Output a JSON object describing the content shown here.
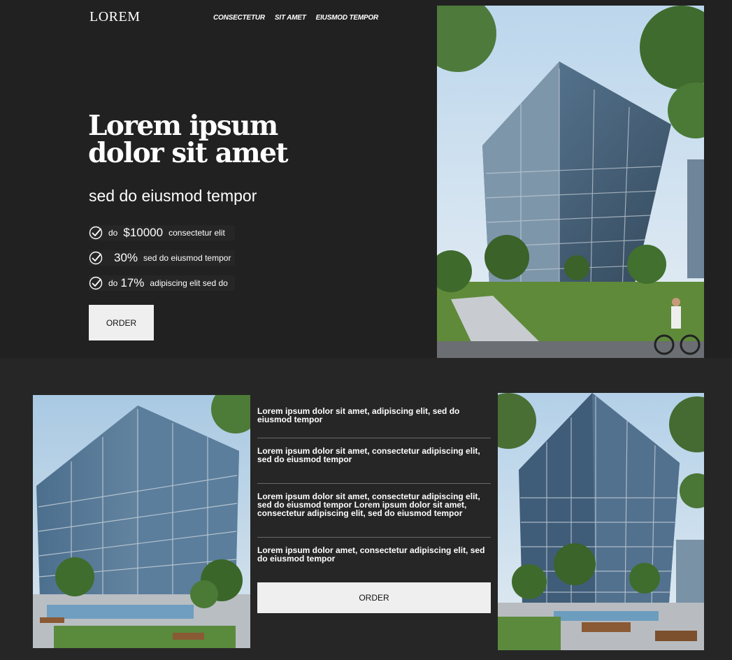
{
  "header": {
    "logo": "LOREM",
    "nav": [
      "CONSECTETUR",
      "SIT AMET",
      "EIUSMOD TEMPOR"
    ]
  },
  "hero": {
    "title": "Lorem ipsum dolor sit amet",
    "subtitle": "sed do eiusmod tempor",
    "features": [
      {
        "prefix": "do",
        "value": "$10000",
        "suffix": "consectetur elit"
      },
      {
        "prefix": "",
        "value": "30%",
        "suffix": "sed do eiusmod tempor"
      },
      {
        "prefix": "do",
        "value": "17%",
        "suffix": "adipiscing elit sed do"
      }
    ],
    "order_label": "ORDER"
  },
  "info": {
    "items": [
      "Lorem ipsum dolor sit amet, adipiscing elit, sed do eiusmod tempor",
      "Lorem ipsum dolor sit amet, consectetur adipiscing elit, sed do eiusmod tempor",
      "Lorem ipsum dolor sit amet, consectetur adipiscing elit, sed do eiusmod tempor Lorem ipsum dolor sit amet, consectetur adipiscing elit, sed do eiusmod tempor",
      "Lorem ipsum dolor amet, consectetur adipiscing elit, sed do eiusmod tempor"
    ],
    "order_label": "ORDER"
  },
  "icons": {
    "feature": "checkmark-circle-icon"
  },
  "colors": {
    "background": "#262626",
    "hero_background": "#212121",
    "button": "#efefef"
  }
}
